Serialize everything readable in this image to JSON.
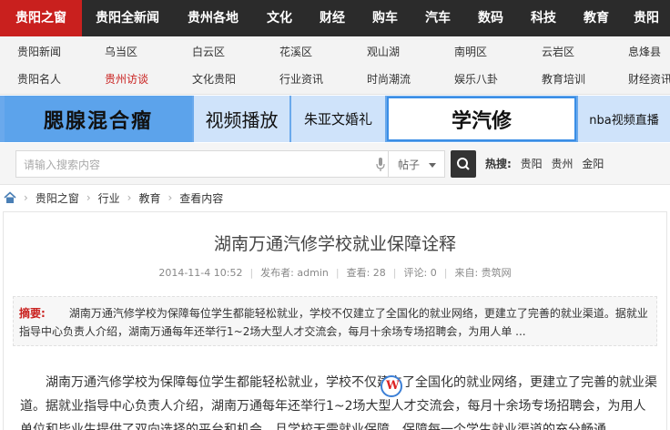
{
  "topnav": {
    "items": [
      "贵阳之窗",
      "贵阳全新闻",
      "贵州各地",
      "文化",
      "财经",
      "购车",
      "汽车",
      "数码",
      "科技",
      "教育",
      "贵阳"
    ]
  },
  "subnav": {
    "row1": [
      "贵阳新闻",
      "乌当区",
      "白云区",
      "花溪区",
      "观山湖",
      "南明区",
      "云岩区",
      "息烽县"
    ],
    "row2": [
      "贵阳名人",
      "贵州访谈",
      "文化贵阳",
      "行业资讯",
      "时尚潮流",
      "娱乐八卦",
      "教育培训",
      "财经资讯"
    ],
    "highlight": "贵州访谈"
  },
  "ads": {
    "ad1": "腮腺混合瘤",
    "ad2": "视频播放",
    "ad3": "朱亚文婚礼",
    "ad4": "学汽修",
    "ad5": "nba视频直播"
  },
  "search": {
    "placeholder": "请输入搜索内容",
    "select_value": "帖子",
    "hot_label": "热搜:",
    "hot_keywords": [
      "贵阳",
      "贵州",
      "金阳"
    ]
  },
  "breadcrumb": [
    "贵阳之窗",
    "行业",
    "教育",
    "查看内容"
  ],
  "article": {
    "title": "湖南万通汽修学校就业保障诠释",
    "date": "2014-11-4 10:52",
    "author_label": "发布者:",
    "author": "admin",
    "views_label": "查看:",
    "views": "28",
    "comments_label": "评论:",
    "comments": "0",
    "source_label": "来自:",
    "source": "贵筑网",
    "summary_label": "摘要:",
    "summary_text": "湖南万通汽修学校为保障每位学生都能轻松就业，学校不仅建立了全国化的就业网络，更建立了完善的就业渠道。据就业指导中心负责人介绍，湖南万通每年还举行1~2场大型人才交流会，每月十余场专场招聘会，为用人单 ...",
    "body_text": "湖南万通汽修学校为保障每位学生都能轻松就业，学校不仅建立了全国化的就业网络，更建立了完善的就业渠道。据就业指导中心负责人介绍，湖南万通每年还举行1~2场大型人才交流会，每月十余场专场招聘会，为用人单位和毕业生提供了双向选择的平台和机会。且学校无需就业保障，保障每一个学生就业渠道的充分畅通。"
  },
  "colors": {
    "nav_bg": "#2b2b2b",
    "nav_active": "#c9201e",
    "ad_blue": "#6aa9ec",
    "accent_red": "#c9201e"
  },
  "icons": [
    "home-icon",
    "microphone-icon",
    "search-icon",
    "chevron-down-icon",
    "watermark-logo-icon"
  ]
}
